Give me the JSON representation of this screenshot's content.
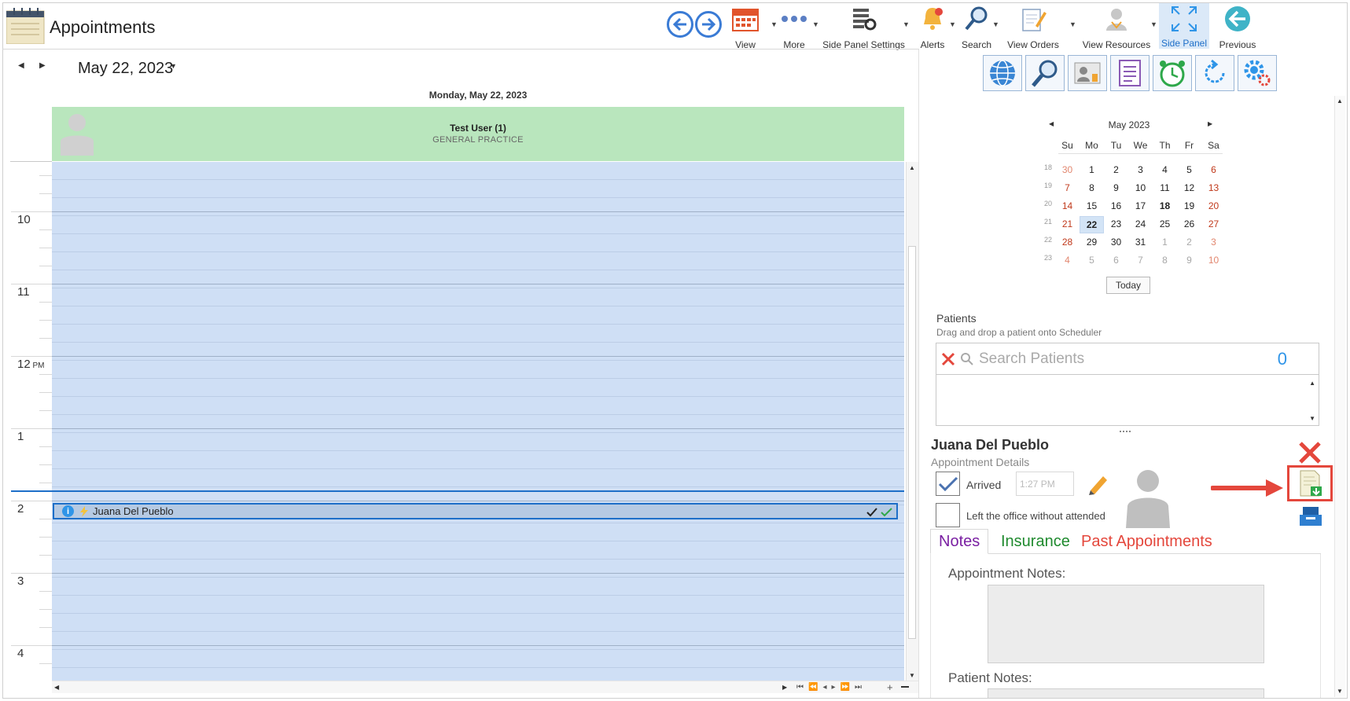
{
  "app": {
    "title": "Appointments"
  },
  "toolbar": {
    "items": [
      {
        "label": "View",
        "icon": "calendar-icon"
      },
      {
        "label": "More",
        "icon": "more-dots-icon"
      },
      {
        "label": "Side Panel Settings",
        "icon": "panel-settings-icon"
      },
      {
        "label": "Alerts",
        "icon": "bell-icon"
      },
      {
        "label": "Search",
        "icon": "search-icon"
      },
      {
        "label": "View Orders",
        "icon": "orders-icon"
      },
      {
        "label": "View Resources",
        "icon": "resources-icon"
      },
      {
        "label": "Side Panel",
        "icon": "expand-icon"
      },
      {
        "label": "Previous",
        "icon": "previous-icon"
      }
    ]
  },
  "scheduler": {
    "date_label": "May 22, 2023",
    "day_header": "Monday, May 22, 2023",
    "resource": {
      "name": "Test User (1)",
      "specialty": "GENERAL PRACTICE"
    },
    "hours": [
      {
        "label": "10",
        "suffix": ""
      },
      {
        "label": "11",
        "suffix": ""
      },
      {
        "label": "12",
        "suffix": "PM"
      },
      {
        "label": "1",
        "suffix": ""
      },
      {
        "label": "2",
        "suffix": ""
      },
      {
        "label": "3",
        "suffix": ""
      },
      {
        "label": "4",
        "suffix": ""
      }
    ],
    "appointment": {
      "patient": "Juana Del Pueblo",
      "status": "arrived"
    }
  },
  "mini_calendar": {
    "month_label": "May 2023",
    "day_headers": [
      "Su",
      "Mo",
      "Tu",
      "We",
      "Th",
      "Fr",
      "Sa"
    ],
    "weeks": [
      {
        "week": "18",
        "days": [
          "30",
          "1",
          "2",
          "3",
          "4",
          "5",
          "6"
        ]
      },
      {
        "week": "19",
        "days": [
          "7",
          "8",
          "9",
          "10",
          "11",
          "12",
          "13"
        ]
      },
      {
        "week": "20",
        "days": [
          "14",
          "15",
          "16",
          "17",
          "18",
          "19",
          "20"
        ]
      },
      {
        "week": "21",
        "days": [
          "21",
          "22",
          "23",
          "24",
          "25",
          "26",
          "27"
        ]
      },
      {
        "week": "22",
        "days": [
          "28",
          "29",
          "30",
          "31",
          "1",
          "2",
          "3"
        ]
      },
      {
        "week": "23",
        "days": [
          "4",
          "5",
          "6",
          "7",
          "8",
          "9",
          "10"
        ]
      }
    ],
    "selected_day": "22",
    "today_day": "18",
    "today_button": "Today"
  },
  "patients": {
    "title": "Patients",
    "subtitle": "Drag and drop a patient onto Scheduler",
    "search_placeholder": "Search Patients",
    "count": "0"
  },
  "details": {
    "patient_name": "Juana Del Pueblo",
    "section_label": "Appointment Details",
    "arrived_label": "Arrived",
    "arrived_checked": true,
    "arrived_time": "1:27 PM",
    "left_office_label": "Left the office without attended",
    "tabs": [
      {
        "label": "Notes",
        "color": "#7a1fa2"
      },
      {
        "label": "Insurance",
        "color": "#1f8a2e"
      },
      {
        "label": "Past Appointments",
        "color": "#e4473c"
      }
    ],
    "appointment_notes_label": "Appointment Notes:",
    "patient_notes_label": "Patient Notes:"
  },
  "colors": {
    "accent": "#1e6fc8",
    "resource_header": "#b9e6bd",
    "grid": "#cfdff5",
    "alert_red": "#e4473c"
  }
}
